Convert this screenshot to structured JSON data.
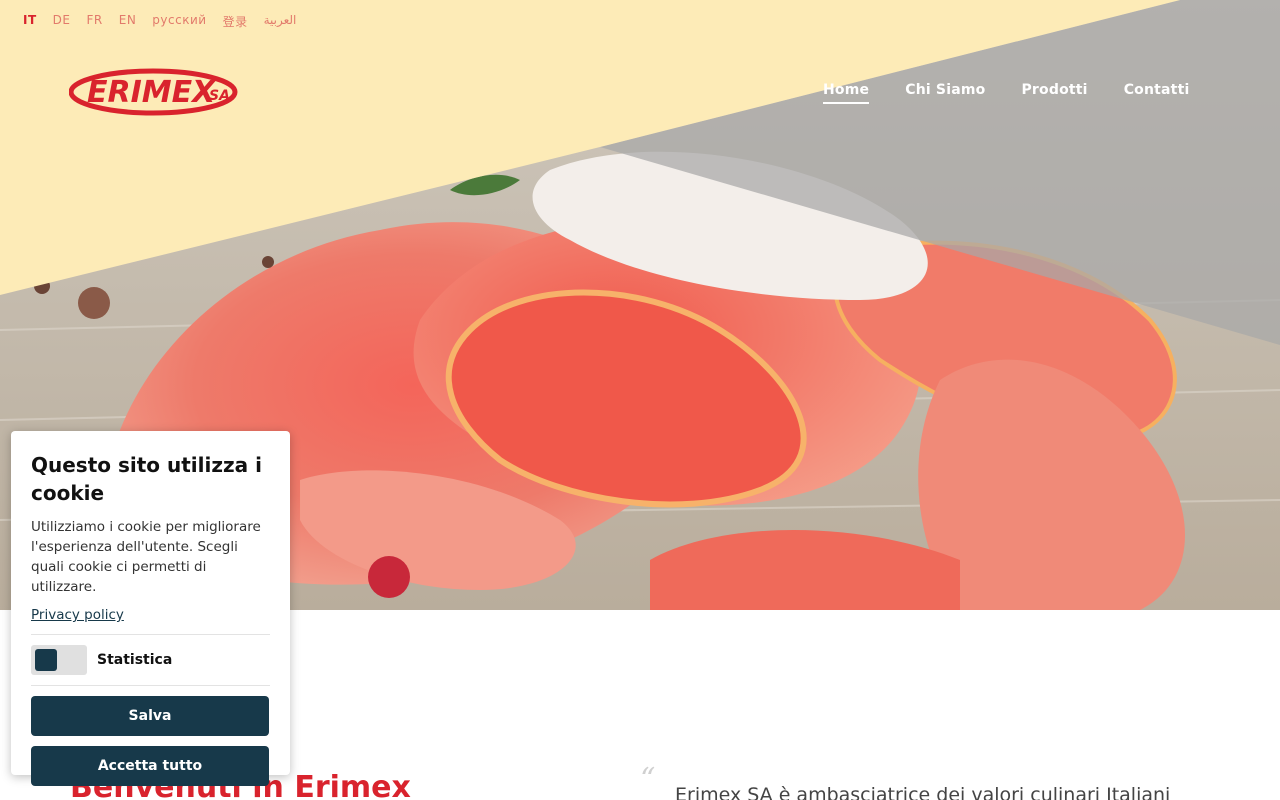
{
  "languages": [
    {
      "label": "IT",
      "active": true
    },
    {
      "label": "DE"
    },
    {
      "label": "FR"
    },
    {
      "label": "EN"
    },
    {
      "label": "русский"
    },
    {
      "label": "登录"
    },
    {
      "label": "العربية"
    }
  ],
  "logo": {
    "text": "ERIMEX",
    "suffix": "SA",
    "color": "#d9232d"
  },
  "nav": {
    "items": [
      {
        "label": "Home",
        "active": true
      },
      {
        "label": "Chi Siamo"
      },
      {
        "label": "Prodotti"
      },
      {
        "label": "Contatti"
      }
    ]
  },
  "main": {
    "welcome": "Benvenuti in Erimex",
    "quote_mark": "“",
    "intro": "Erimex SA è ambasciatrice dei valori culinari Italiani"
  },
  "cookie_dialog": {
    "title": "Questo sito utilizza i cookie",
    "body": "Utilizziamo i cookie per migliorare l'esperienza dell'utente. Scegli quali cookie ci permetti di utilizzare.",
    "privacy_link": "Privacy policy",
    "toggle_label": "Statistica",
    "save_label": "Salva",
    "accept_all_label": "Accetta tutto"
  },
  "colors": {
    "brand_red": "#d9232d",
    "band_yellow": "#fdebb7",
    "dark_button": "#17394a"
  }
}
